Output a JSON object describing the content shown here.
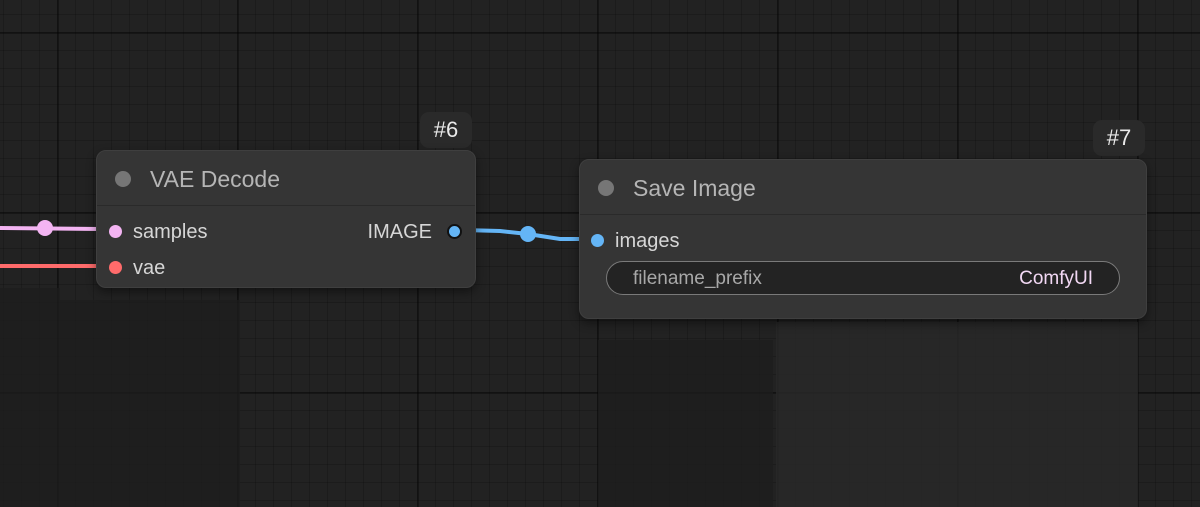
{
  "canvas": {
    "background_color": "#222222"
  },
  "links": {
    "latent_color": "#f3b4f2",
    "vae_color": "#ff6b6b",
    "image_color": "#64b5f6"
  },
  "nodes": {
    "vae_decode": {
      "id_badge": "#6",
      "title": "VAE Decode",
      "inputs": [
        {
          "label": "samples",
          "color": "#f3b4f2"
        },
        {
          "label": "vae",
          "color": "#ff6b6b"
        }
      ],
      "outputs": [
        {
          "label": "IMAGE",
          "color": "#64b5f6"
        }
      ]
    },
    "save_image": {
      "id_badge": "#7",
      "title": "Save Image",
      "inputs": [
        {
          "label": "images",
          "color": "#64b5f6"
        }
      ],
      "widgets": [
        {
          "label": "filename_prefix",
          "value": "ComfyUI"
        }
      ]
    }
  }
}
